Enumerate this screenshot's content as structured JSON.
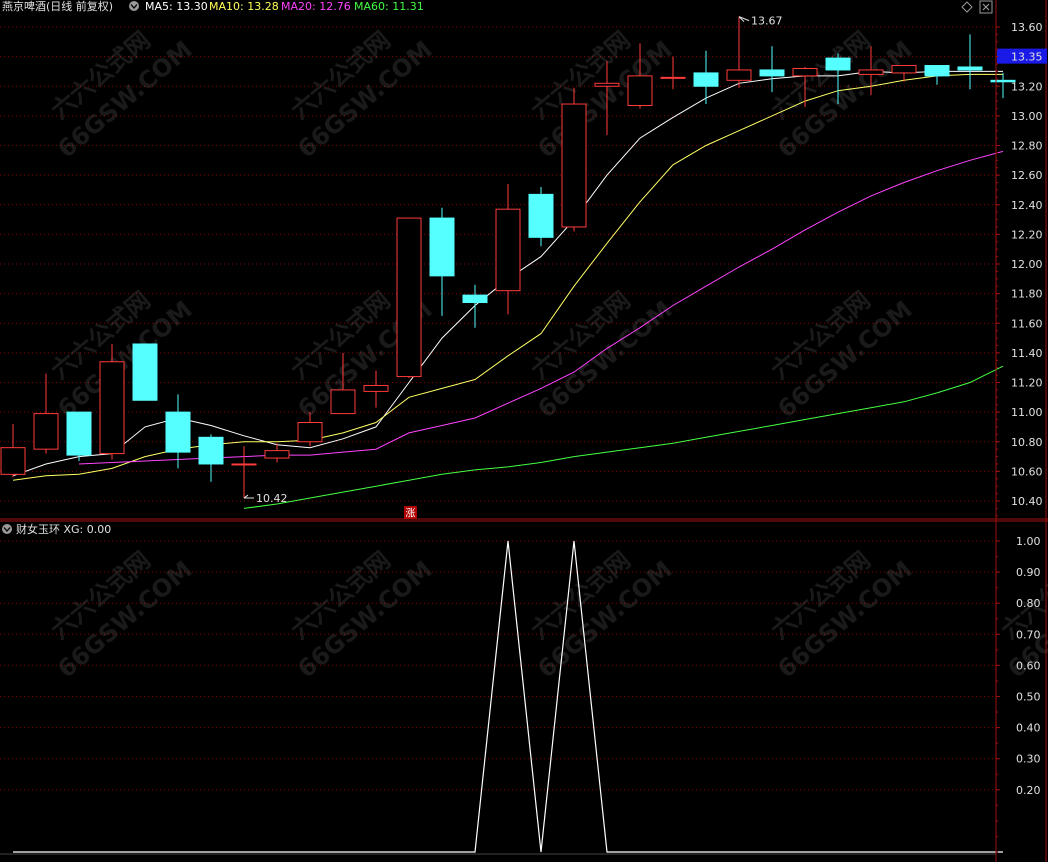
{
  "header": {
    "main_title": "燕京啤酒(日线 前复权)",
    "ma_labels": [
      {
        "text": "MA5: 13.30",
        "color": "#ffffff"
      },
      {
        "text": "MA10: 13.28",
        "color": "#ffff55"
      },
      {
        "text": "MA20: 12.76",
        "color": "#ff44ff"
      },
      {
        "text": "MA60: 11.31",
        "color": "#44ff44"
      }
    ],
    "sub_title": "财女玉环  XG: 0.00",
    "limit_badge": "涨"
  },
  "watermarks": [
    "六六公式网",
    "66GSW.COM"
  ],
  "colors": {
    "up": "#ff3b3b",
    "down": "#55ffff",
    "grid": "#8b0000",
    "axis": "#a01010",
    "price_box": "#1a1ae6"
  },
  "chart_data": [
    {
      "type": "candlestick",
      "ylim": [
        10.3,
        13.65
      ],
      "yticks": [
        10.4,
        10.6,
        10.8,
        11.0,
        11.2,
        11.4,
        11.6,
        11.8,
        12.0,
        12.2,
        12.4,
        12.6,
        12.8,
        13.0,
        13.2,
        13.4,
        13.6
      ],
      "tick_labels": [
        "10.40",
        "10.60",
        "10.80",
        "11.00",
        "11.20",
        "11.40",
        "11.60",
        "11.80",
        "12.00",
        "12.20",
        "12.40",
        "12.60",
        "12.80",
        "13.00",
        "13.20",
        "13.35",
        "13.60"
      ],
      "current_price": "13.35",
      "high_label": "13.67",
      "low_label": "10.42",
      "candles": [
        {
          "o": 10.58,
          "h": 10.92,
          "l": 10.56,
          "c": 10.76
        },
        {
          "o": 10.75,
          "h": 11.26,
          "l": 10.72,
          "c": 10.99
        },
        {
          "o": 11.0,
          "h": 11.0,
          "l": 10.67,
          "c": 10.71
        },
        {
          "o": 10.72,
          "h": 11.46,
          "l": 10.68,
          "c": 11.34
        },
        {
          "o": 11.46,
          "h": 11.46,
          "l": 11.08,
          "c": 11.08
        },
        {
          "o": 11.0,
          "h": 11.12,
          "l": 10.62,
          "c": 10.73
        },
        {
          "o": 10.83,
          "h": 10.85,
          "l": 10.53,
          "c": 10.65
        },
        {
          "o": 10.65,
          "h": 10.77,
          "l": 10.42,
          "c": 10.65
        },
        {
          "o": 10.69,
          "h": 10.79,
          "l": 10.66,
          "c": 10.74
        },
        {
          "o": 10.8,
          "h": 11.0,
          "l": 10.77,
          "c": 10.93
        },
        {
          "o": 10.99,
          "h": 11.4,
          "l": 10.99,
          "c": 11.15
        },
        {
          "o": 11.14,
          "h": 11.28,
          "l": 11.03,
          "c": 11.18
        },
        {
          "o": 11.24,
          "h": 12.31,
          "l": 11.23,
          "c": 12.31
        },
        {
          "o": 12.31,
          "h": 12.38,
          "l": 11.65,
          "c": 11.92
        },
        {
          "o": 11.79,
          "h": 11.86,
          "l": 11.57,
          "c": 11.74
        },
        {
          "o": 11.82,
          "h": 12.54,
          "l": 11.66,
          "c": 12.37
        },
        {
          "o": 12.47,
          "h": 12.52,
          "l": 12.12,
          "c": 12.18
        },
        {
          "o": 12.25,
          "h": 13.19,
          "l": 12.22,
          "c": 13.08
        },
        {
          "o": 13.2,
          "h": 13.37,
          "l": 12.87,
          "c": 13.22
        },
        {
          "o": 13.07,
          "h": 13.49,
          "l": 13.05,
          "c": 13.27
        },
        {
          "o": 13.26,
          "h": 13.4,
          "l": 13.18,
          "c": 13.26
        },
        {
          "o": 13.29,
          "h": 13.44,
          "l": 13.08,
          "c": 13.2
        },
        {
          "o": 13.24,
          "h": 13.67,
          "l": 13.19,
          "c": 13.31
        },
        {
          "o": 13.31,
          "h": 13.47,
          "l": 13.16,
          "c": 13.27
        },
        {
          "o": 13.27,
          "h": 13.33,
          "l": 13.06,
          "c": 13.32
        },
        {
          "o": 13.39,
          "h": 13.42,
          "l": 13.08,
          "c": 13.31
        },
        {
          "o": 13.28,
          "h": 13.47,
          "l": 13.14,
          "c": 13.31
        },
        {
          "o": 13.29,
          "h": 13.34,
          "l": 13.23,
          "c": 13.34
        },
        {
          "o": 13.34,
          "h": 13.34,
          "l": 13.21,
          "c": 13.27
        },
        {
          "o": 13.33,
          "h": 13.55,
          "l": 13.18,
          "c": 13.31
        },
        {
          "o": 13.24,
          "h": 13.29,
          "l": 13.12,
          "c": 13.23
        }
      ],
      "series": [
        {
          "name": "MA5",
          "color": "#ffffff",
          "values": [
            10.57,
            10.65,
            10.7,
            10.72,
            10.9,
            10.96,
            10.91,
            10.84,
            10.78,
            10.76,
            10.82,
            10.9,
            11.2,
            11.5,
            11.72,
            11.9,
            12.05,
            12.3,
            12.6,
            12.85,
            12.99,
            13.12,
            13.22,
            13.25,
            13.27,
            13.27,
            13.3,
            13.29,
            13.3,
            13.3,
            13.3
          ]
        },
        {
          "name": "MA10",
          "color": "#ffff66",
          "values": [
            10.54,
            10.57,
            10.58,
            10.62,
            10.7,
            10.75,
            10.78,
            10.8,
            10.8,
            10.81,
            10.86,
            10.93,
            11.1,
            11.16,
            11.22,
            11.38,
            11.53,
            11.85,
            12.14,
            12.42,
            12.67,
            12.8,
            12.9,
            13.0,
            13.1,
            13.17,
            13.2,
            13.24,
            13.27,
            13.28,
            13.28
          ]
        },
        {
          "name": "MA20",
          "color": "#ff44ff",
          "values": [
            null,
            null,
            10.65,
            10.66,
            10.67,
            10.68,
            10.69,
            10.7,
            10.71,
            10.71,
            10.73,
            10.75,
            10.86,
            10.91,
            10.96,
            11.06,
            11.16,
            11.27,
            11.43,
            11.57,
            11.72,
            11.85,
            11.98,
            12.1,
            12.23,
            12.35,
            12.46,
            12.55,
            12.63,
            12.7,
            12.76
          ]
        },
        {
          "name": "MA60",
          "color": "#44ff44",
          "values": [
            null,
            null,
            null,
            null,
            null,
            null,
            null,
            10.35,
            10.38,
            10.42,
            10.46,
            10.5,
            10.54,
            10.58,
            10.61,
            10.63,
            10.66,
            10.7,
            10.73,
            10.76,
            10.79,
            10.83,
            10.87,
            10.91,
            10.95,
            10.99,
            11.03,
            11.07,
            11.13,
            11.2,
            11.31
          ]
        }
      ]
    },
    {
      "type": "line",
      "name": "XG",
      "ylim": [
        0,
        1.0
      ],
      "yticks": [
        0.2,
        0.3,
        0.4,
        0.5,
        0.6,
        0.7,
        0.8,
        0.9,
        1.0
      ],
      "tick_labels": [
        "0.20",
        "0.30",
        "0.40",
        "0.50",
        "0.60",
        "0.70",
        "0.80",
        "0.90",
        "1.00"
      ],
      "color": "#ffffff",
      "values": [
        0,
        0,
        0,
        0,
        0,
        0,
        0,
        0,
        0,
        0,
        0,
        0,
        0,
        0,
        0,
        1,
        0,
        1,
        0,
        0,
        0,
        0,
        0,
        0,
        0,
        0,
        0,
        0,
        0,
        0,
        0
      ]
    }
  ]
}
